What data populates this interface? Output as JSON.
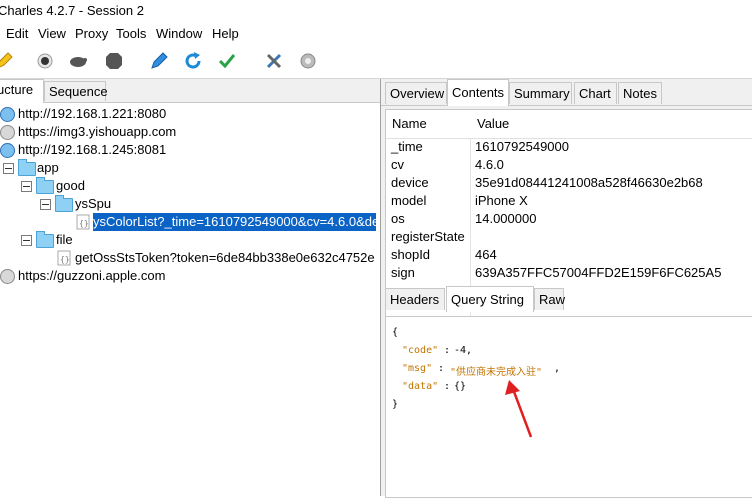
{
  "window": {
    "title": "Charles 4.2.7 - Session 2"
  },
  "menu": [
    "Edit",
    "View",
    "Proxy",
    "Tools",
    "Window",
    "Help"
  ],
  "toolbar_icons": [
    "pen-icon",
    "record-icon",
    "turtle-icon",
    "stop-icon",
    "compose-icon",
    "refresh-icon",
    "check-icon",
    "tools-icon",
    "settings-icon"
  ],
  "left_panel": {
    "tabs": [
      "ucture",
      "Sequence"
    ],
    "tree": {
      "host1": "http://192.168.1.221:8080",
      "host2": "https://img3.yishouapp.com",
      "host3": "http://192.168.1.245:8081",
      "app": "app",
      "good": "good",
      "ysspu": "ysSpu",
      "selected": "ysColorList?_time=1610792549000&cv=4.6.0&de",
      "file": "file",
      "oss": "getOssStsToken?token=6de84bb338e0e632c4752e",
      "host4": "https://guzzoni.apple.com"
    }
  },
  "right_panel": {
    "tabs": [
      "Overview",
      "Contents",
      "Summary",
      "Chart",
      "Notes"
    ],
    "active_tab": "Contents",
    "table": {
      "headers": [
        "Name",
        "Value"
      ],
      "rows": [
        [
          "_time",
          "1610792549000"
        ],
        [
          "cv",
          "4.6.0"
        ],
        [
          "device",
          "35e91d08441241008a528f46630e2b68"
        ],
        [
          "model",
          "iPhone X"
        ],
        [
          "os",
          "14.000000"
        ],
        [
          "registerState",
          ""
        ],
        [
          "shopId",
          "464"
        ],
        [
          "sign",
          "639A357FFC57004FFD2E159F6FC625A5"
        ]
      ]
    },
    "bottom_tabs": [
      "Headers",
      "Query String",
      "Raw"
    ],
    "active_bottom_tab": "Query String",
    "json": {
      "open": "{",
      "code_key": "\"code\"",
      "code_val": "-4",
      "msg_key": "\"msg\"",
      "msg_val": "\"供应商未完成入驻\"",
      "data_key": "\"data\"",
      "data_val": "{}",
      "close": "}"
    }
  },
  "colors": {
    "selection": "#0b63c5",
    "json_key": "#c27400",
    "json_val": "#1a1a1a",
    "arrow": "#e02020"
  }
}
